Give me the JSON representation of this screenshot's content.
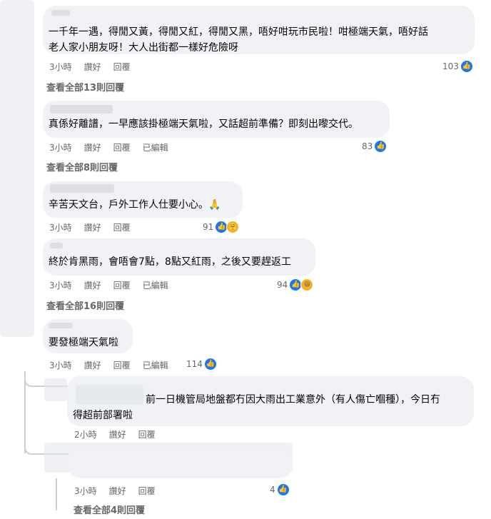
{
  "comments": [
    {
      "text": "一千年一遇，得閒又黃，得閒又紅，得閒又黑，唔好咁玩市民啦！咁極端天氣，唔好話\n老人家小朋友呀！大人出街都一樣好危險呀",
      "time": "3小時",
      "like_label": "讚好",
      "reply_label": "回覆",
      "edited": "",
      "reaction_count": "103",
      "view_replies": "查看全部13則回覆"
    },
    {
      "text": "真係好離譜，一早應該掛極端天氣啦，又話超前準備？即刻出嚟交代。",
      "time": "3小時",
      "like_label": "讚好",
      "reply_label": "回覆",
      "edited": "已編輯",
      "reaction_count": "83",
      "view_replies": "查看全部8則回覆"
    },
    {
      "text": "辛苦天文台，戶外工作人仕要小心。🙏",
      "time": "3小時",
      "like_label": "讚好",
      "reply_label": "回覆",
      "edited": "",
      "reaction_count": "91",
      "view_replies": ""
    },
    {
      "text": "終於肯黑雨，會唔會7點，8點又紅雨，之後又要趕返工",
      "time": "3小時",
      "like_label": "讚好",
      "reply_label": "回覆",
      "edited": "已編輯",
      "reaction_count": "94",
      "view_replies": "查看全部16則回覆"
    },
    {
      "text": "要發極端天氣啦",
      "time": "3小時",
      "like_label": "讚好",
      "reply_label": "回覆",
      "edited": "已編輯",
      "reaction_count": "114",
      "view_replies": ""
    }
  ],
  "replies": [
    {
      "text": "前一日機管局地盤都冇因大雨出工業意外（有人傷亡嗰種），今日冇\n得超前部署啦",
      "time": "2小時",
      "like_label": "讚好",
      "reply_label": "回覆"
    },
    {
      "text": "",
      "time": "3小時",
      "like_label": "讚好",
      "reply_label": "回覆",
      "reaction_count": "4",
      "view_replies": "查看全部4則回覆"
    }
  ],
  "icons": {
    "like": "thumbs-up-icon",
    "haha": "laughing-face-icon",
    "care": "care-face-icon"
  },
  "colors": {
    "like_blue": "#1877f2",
    "bubble": "#f0f2f5",
    "meta_text": "#65676b"
  }
}
